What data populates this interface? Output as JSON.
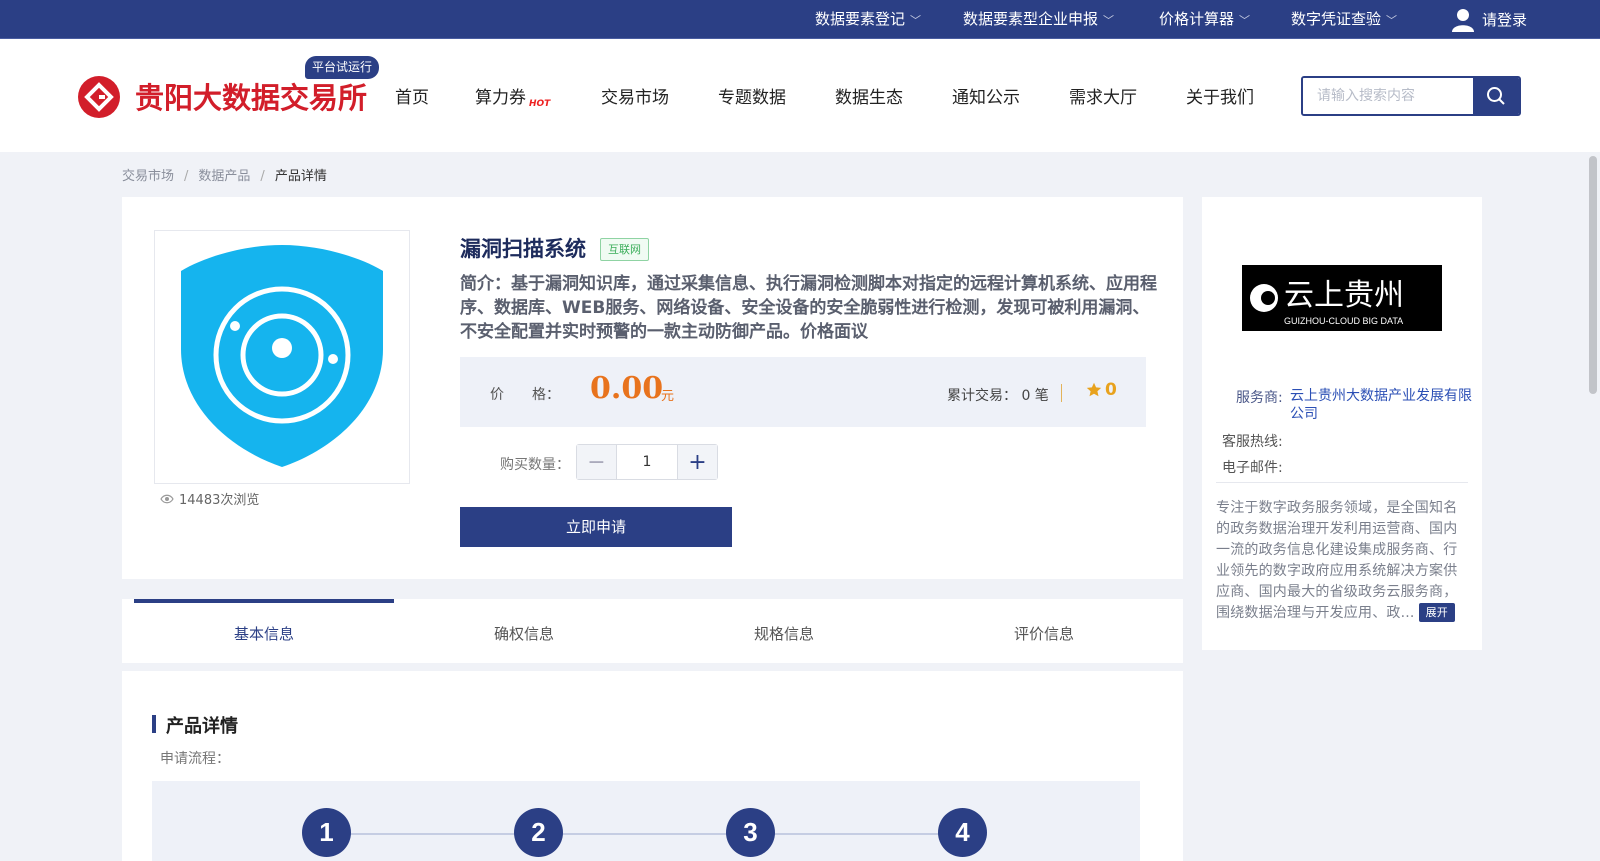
{
  "topbar": {
    "links": [
      {
        "label": "数据要素登记"
      },
      {
        "label": "数据要素型企业申报"
      },
      {
        "label": "价格计算器"
      },
      {
        "label": "数字凭证查验"
      }
    ],
    "login_label": "请登录"
  },
  "header": {
    "logo_text": "贵阳大数据交易所",
    "trial_badge": "平台试运行",
    "nav": [
      {
        "label": "首页"
      },
      {
        "label": "算力券",
        "badge": "HOT"
      },
      {
        "label": "交易市场"
      },
      {
        "label": "专题数据"
      },
      {
        "label": "数据生态"
      },
      {
        "label": "通知公示"
      },
      {
        "label": "需求大厅"
      },
      {
        "label": "关于我们"
      }
    ],
    "search": {
      "placeholder": "请输入搜索内容",
      "value": ""
    }
  },
  "breadcrumb": {
    "items": [
      "交易市场",
      "数据产品"
    ],
    "current": "产品详情"
  },
  "product": {
    "title": "漏洞扫描系统",
    "tag": "互联网",
    "description": "简介：基于漏洞知识库，通过采集信息、执行漏洞检测脚本对指定的远程计算机系统、应用程序、数据库、WEB服务、网络设备、安全设备的安全脆弱性进行检测，发现可被利用漏洞、不安全配置并实时预警的一款主动防御产品。价格面议",
    "views": "14483次浏览",
    "price_label": "价　　格：",
    "price": "0.00",
    "price_unit": "元",
    "trade_label": "累计交易：",
    "trade_count": "0 笔",
    "rating": "0",
    "quantity_label": "购买数量：",
    "quantity": "1",
    "apply_label": "立即申请"
  },
  "tabs": [
    {
      "label": "基本信息",
      "active": true
    },
    {
      "label": "确权信息",
      "active": false
    },
    {
      "label": "规格信息",
      "active": false
    },
    {
      "label": "评价信息",
      "active": false
    }
  ],
  "detail": {
    "title": "产品详情",
    "flow_label": "申请流程：",
    "steps": [
      "1",
      "2",
      "3",
      "4"
    ]
  },
  "vendor": {
    "logo_text": "云上贵州",
    "logo_subtext": "GUIZHOU-CLOUD BIG DATA",
    "provider_label": "服务商:",
    "provider": "云上贵州大数据产业发展有限公司",
    "hotline_label": "客服热线:",
    "email_label": "电子邮件:",
    "intro": "专注于数字政务服务领域，是全国知名的政务数据治理开发利用运营商、国内一流的政务信息化建设集成服务商、行业领先的数字政府应用系统解决方案供应商、国内最大的省级政务云服务商，围绕数据治理与开发应用、政...",
    "expand_label": "展开"
  },
  "colors": {
    "brand_navy": "#2b3f85",
    "brand_red": "#d21e2a",
    "price_orange": "#e8731d",
    "tag_green": "#3cae5b",
    "shield_blue": "#15b4ee"
  }
}
